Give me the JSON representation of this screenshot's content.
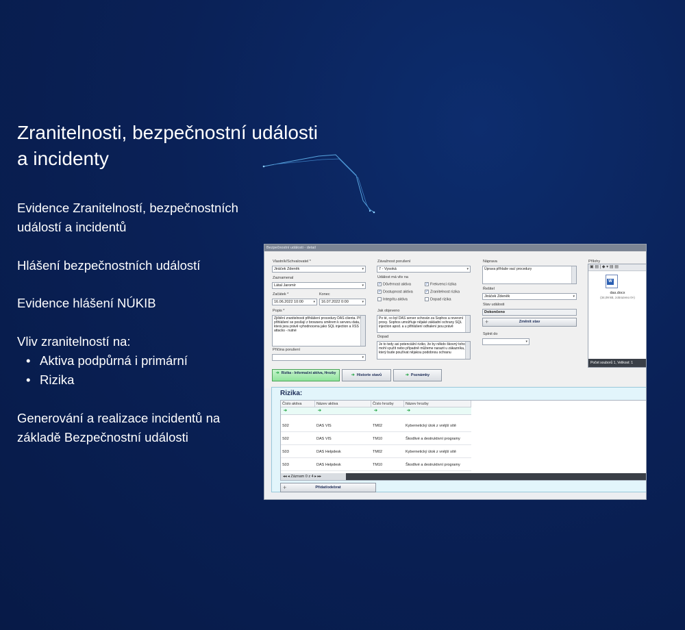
{
  "slide": {
    "heading_line1": "Zranitelnosti, bezpečnostní události",
    "heading_line2": "a incidenty",
    "p1_line1": "Evidence Zranitelností, bezpečnostních",
    "p1_line2": "událostí a incidentů",
    "p2": "Hlášení bezpečnostních událostí",
    "p3": "Evidence hlášení NÚKIB",
    "p4": "Vliv zranitelností na:",
    "bullets": [
      "Aktiva podpůrná i primární",
      "Rizika"
    ],
    "p5_line1": "Generování a realizace incidentů na",
    "p5_line2": "základě Bezpečnostní události"
  },
  "app": {
    "title": "Bezpečnostní události - detail",
    "owner_label": "Vlastník/Schvalovatel *",
    "owner_value": "Jiráček Zdeněk",
    "recorder_label": "Zaznamenal",
    "recorder_value": "Látal Jaromír",
    "start_label": "Začátek *",
    "start_value": "16.06.2022 10:00",
    "end_label": "Konec",
    "end_value": "16.07.2022 0:00",
    "desc_label": "Popis *",
    "desc_value": "Zjištění zranitelnosti přihlášení procedury DAS clienta. Při přihlášení se posílají z browseru směrem k serveru data, která jsou právě vyhodnocena jako SQL injection a XSS attacks - nutné",
    "cause_label": "Příčina porušení",
    "cause_value": "",
    "severity_label": "Závažnost porušení",
    "severity_value": "7 - Vysoká",
    "impact_label": "Událost má vliv na",
    "checks": [
      {
        "label": "Důvěrnost aktiva",
        "checked": true
      },
      {
        "label": "Frekvenci rizika",
        "checked": true
      },
      {
        "label": "Dostupnost aktiva",
        "checked": true
      },
      {
        "label": "Zranitelnost rizika",
        "checked": true
      },
      {
        "label": "Integritu aktiva",
        "checked": false
      },
      {
        "label": "Dopad rizika",
        "checked": false
      }
    ],
    "discovered_label": "Jak objeveno",
    "discovered_value": "Po té, co byl DAS server schován za Sophos a reverzní proxy. Sophos umožňuje nějaké základní ochrany SQL injection apod. a u přihlášení odhalení jsou právě",
    "impact2_label": "Dopad",
    "impact2_value": "Je to tedy asi potenciální riziko, že by někdo škovný toho mohl využít nebo případně můžeme narazit u zákazníka, který bude používat nějakou podobnou ochranu",
    "fix_label": "Náprava",
    "fix_value": "Úprava přihlaše vací procedury",
    "solver_label": "Řešitel",
    "solver_value": "Jiráček Zdeněk",
    "state_label": "Stav události",
    "state_value": "Dokončeno",
    "change_state_btn": "Změnit stav",
    "fulfill_label": "Splnit do",
    "fulfill_value": "",
    "attachments_label": "Přílohy",
    "toolbar_icons": "▣ ▤ | ◆ ▾ ▤ ▤",
    "file_name": "das.docx",
    "file_size": "(34,09 kB, zobrazeno 0×)",
    "attach_footer": "Počet souborů 1, Velikost: 1",
    "tab_risks": "Rizika - Informační aktiva, Hrozby",
    "tab_history": "Historie stavů",
    "tab_notes": "Poznámky",
    "risks_title": "Rizika:",
    "columns": [
      "Číslo aktiva",
      "Název aktiva",
      "Číslo hrozby",
      "Název hrozby"
    ],
    "rows": [
      [
        "S02",
        "DAS VIS",
        "TM02",
        "Kybernetický útok z vnější sítě"
      ],
      [
        "S02",
        "DAS VIS",
        "TM10",
        "Škodlivé a destruktivní programy"
      ],
      [
        "S03",
        "DAS Helpdesk",
        "TM02",
        "Kybernetický útok z vnější sítě"
      ],
      [
        "S03",
        "DAS Helpdesk",
        "TM10",
        "Škodlivé a destruktivní programy"
      ]
    ],
    "pager": "Záznam 0 z 4",
    "add_btn": "Přidat/odebrat"
  }
}
